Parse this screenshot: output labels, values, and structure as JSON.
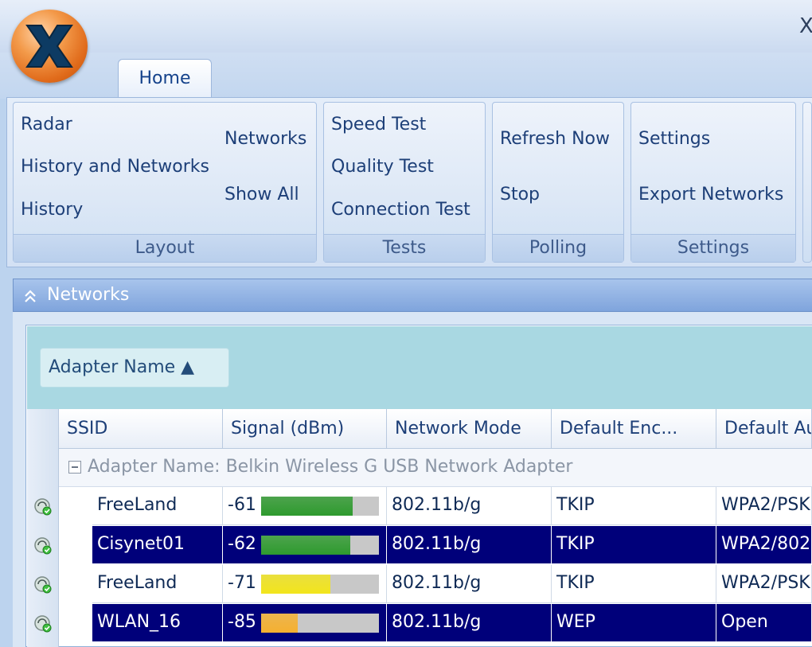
{
  "window": {
    "close_glyph": "X"
  },
  "ribbon": {
    "tabs": [
      {
        "label": "Home"
      }
    ],
    "groups": {
      "layout": {
        "title": "Layout",
        "items": [
          "Radar",
          "History and Networks",
          "History",
          "Networks",
          "Show All"
        ]
      },
      "tests": {
        "title": "Tests",
        "items": [
          "Speed Test",
          "Quality Test",
          "Connection Test"
        ]
      },
      "polling": {
        "title": "Polling",
        "items": [
          "Refresh Now",
          "Stop"
        ]
      },
      "settings": {
        "title": "Settings",
        "items": [
          "Settings",
          "Export Networks"
        ]
      }
    }
  },
  "panel": {
    "title": "Networks",
    "group_by_chip": "Adapter Name ▲",
    "columns": [
      "SSID",
      "Signal (dBm)",
      "Network Mode",
      "Default Enc...",
      "Default Au"
    ],
    "group_row": "Adapter Name: Belkin Wireless G USB Network Adapter",
    "rows": [
      {
        "ssid": "FreeLand",
        "signal": "-61",
        "signal_level": 0.78,
        "bar_color": "#2e9a2e",
        "mode": "802.11b/g",
        "enc": "TKIP",
        "auth": "WPA2/PSK",
        "selected": false
      },
      {
        "ssid": "Cisynet01",
        "signal": "-62",
        "signal_level": 0.76,
        "bar_color": "#2e9a2e",
        "mode": "802.11b/g",
        "enc": "TKIP",
        "auth": "WPA2/802",
        "selected": true
      },
      {
        "ssid": "FreeLand",
        "signal": "-71",
        "signal_level": 0.59,
        "bar_color": "#f2e51c",
        "mode": "802.11b/g",
        "enc": "TKIP",
        "auth": "WPA2/PSK",
        "selected": false
      },
      {
        "ssid": "WLAN_16",
        "signal": "-85",
        "signal_level": 0.31,
        "bar_color": "#f5b030",
        "mode": "802.11b/g",
        "enc": "WEP",
        "auth": "Open",
        "selected": true
      }
    ]
  },
  "icons": {
    "app": "app-orb-icon",
    "collapse": "chevron-up-double-icon",
    "row": "network-status-icon"
  }
}
